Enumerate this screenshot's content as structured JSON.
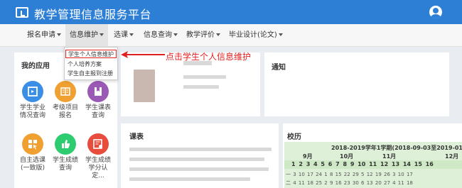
{
  "header": {
    "title": "教学管理信息服务平台"
  },
  "menu": [
    {
      "label": "报名申请"
    },
    {
      "label": "信息维护"
    },
    {
      "label": "选课"
    },
    {
      "label": "信息查询"
    },
    {
      "label": "教学评价"
    },
    {
      "label": "毕业设计(论文)"
    }
  ],
  "dropdown": {
    "items": [
      {
        "label": "学生个人信息维护"
      },
      {
        "label": "个人培养方案"
      },
      {
        "label": "学生自主报到注册"
      }
    ]
  },
  "annotation": {
    "text": "点击学生个人信息维护"
  },
  "apps": {
    "title": "我的应用",
    "tiles": [
      {
        "label": "学生学业情况查询",
        "color": "#3a8ee6",
        "icon": "grid-icon"
      },
      {
        "label": "考级项目报名",
        "color": "#f0a030",
        "icon": "book-icon"
      },
      {
        "label": "学生课表查询",
        "color": "#9b59b6",
        "icon": "bookmark-icon"
      },
      {
        "label": "自主选课(一致版)",
        "color": "#f0a030",
        "icon": "cursor-grid-icon"
      },
      {
        "label": "学生成绩查询",
        "color": "#2ecc71",
        "icon": "thumb-icon"
      },
      {
        "label": "学生成绩学分认定...",
        "color": "#e74c3c",
        "icon": "cert-icon"
      }
    ]
  },
  "notice": {
    "title": "通知"
  },
  "schedule": {
    "title": "课表"
  },
  "calendar": {
    "title": "校历",
    "term": "2018-2019学年1学期(2018-09-03至2019-01",
    "months": [
      "9月",
      "10月",
      "11月",
      "12月"
    ],
    "week_numbers": "1 2 3 4 5 6 7 8 9 10 11 12 13 14 15 16",
    "rows": [
      "一 3 10 17 24 1 8 15 22 29  5 12 19 26  3 10 17",
      "二 4 11 18 25 2 9 16 23 30  6 13 20 27  4 11 18"
    ]
  }
}
